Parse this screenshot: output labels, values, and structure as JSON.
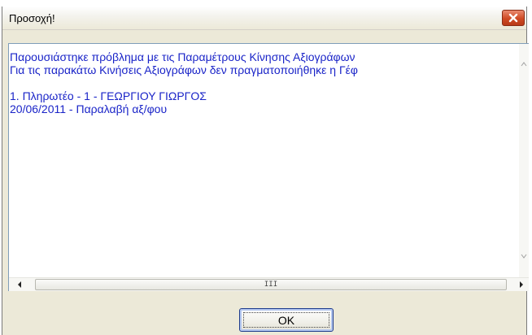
{
  "window": {
    "title": "Προσοχή!",
    "close_icon": "close-icon"
  },
  "message": {
    "lines": [
      "Παρουσιάστηκε πρόβλημα με τις Παραμέτρους Κίνησης Αξιογράφων",
      "Για τις παρακάτω Κινήσεις Αξιογράφων δεν πραγματοποιήθηκε η Γέφ",
      "",
      "1. Πληρωτέο - 1 - ΓΕΩΡΓΙΟΥ ΓΙΩΡΓΟΣ",
      "20/06/2011 - Παραλαβή αξ/φου"
    ]
  },
  "scrollbar": {
    "grip": "III"
  },
  "buttons": {
    "ok_label": "OK"
  },
  "colors": {
    "message_text": "#1a24c8",
    "close_button": "#cf4a24",
    "dialog_background": "#ece9d8"
  }
}
